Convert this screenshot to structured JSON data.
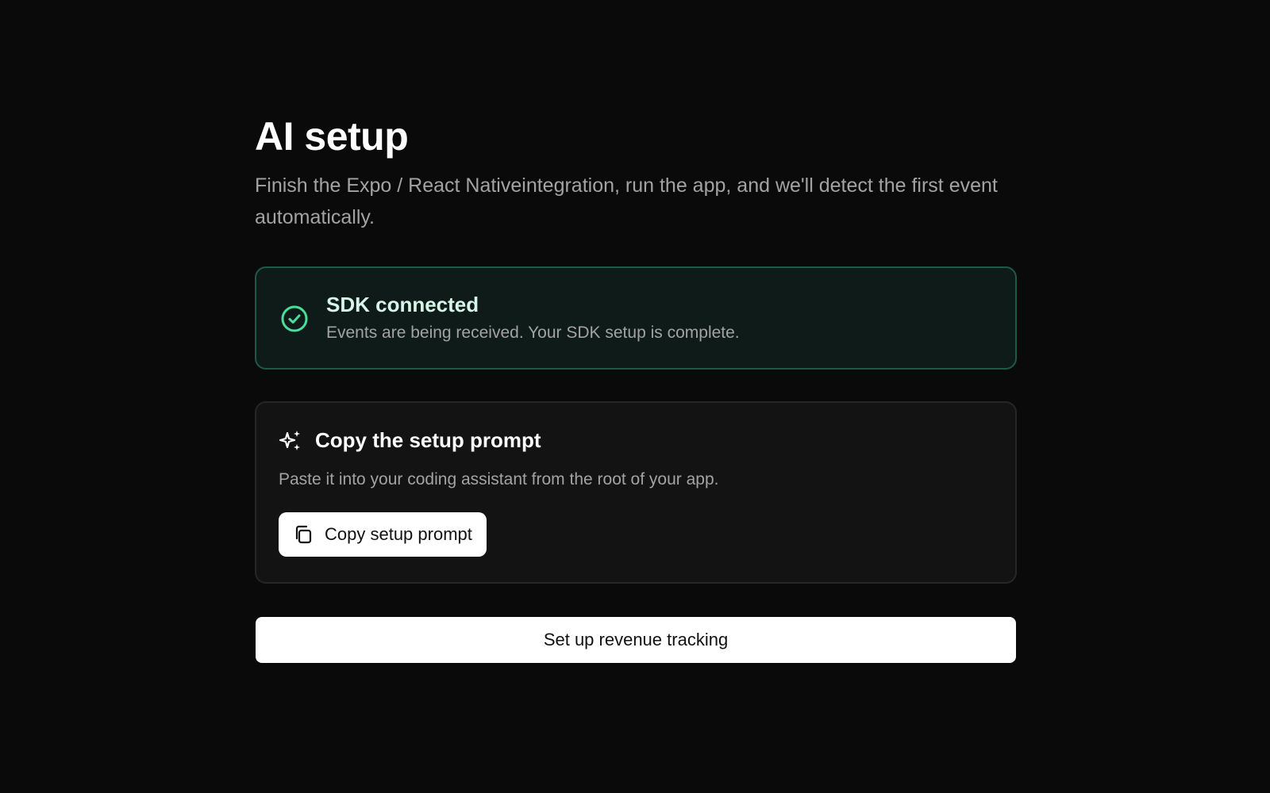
{
  "header": {
    "title": "AI setup",
    "subtitle": "Finish the Expo / React Nativeintegration, run the app, and we'll detect the first event automatically."
  },
  "status": {
    "icon": "check-circle-icon",
    "title": "SDK connected",
    "description": "Events are being received. Your SDK setup is complete.",
    "accent_color": "#4ade9a"
  },
  "prompt_card": {
    "icon": "sparkle-icon",
    "title": "Copy the setup prompt",
    "description": "Paste it into your coding assistant from the root of your app.",
    "button": {
      "icon": "copy-icon",
      "label": "Copy setup prompt"
    }
  },
  "primary_action": {
    "label": "Set up revenue tracking"
  }
}
